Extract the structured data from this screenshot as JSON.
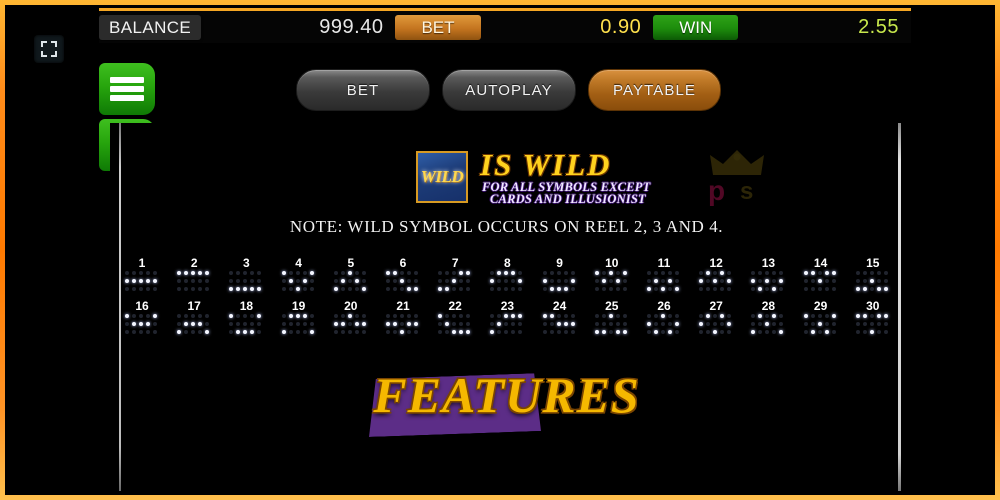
{
  "window": {
    "frame_color": "#ff8c1a",
    "background": "#000000"
  },
  "controls": {
    "fullscreen_icon": "fullscreen-expand-icon",
    "menu_icon": "hamburger-menu-icon",
    "back_icon": "back-arrow-icon"
  },
  "statusbar": {
    "balance_label": "BALANCE",
    "balance_value": "999.40",
    "bet_label": "BET",
    "bet_value": "0.90",
    "win_label": "WIN",
    "win_value": "2.55",
    "bet_color": "#c4741f",
    "win_color": "#1d8c0c",
    "value_colors": {
      "balance": "#e8e8e8",
      "bet": "#ffe14d",
      "win": "#c8e84d"
    }
  },
  "tabs": [
    {
      "label": "BET",
      "state": "inactive"
    },
    {
      "label": "AUTOPLAY",
      "state": "inactive"
    },
    {
      "label": "PAYTABLE",
      "state": "active"
    }
  ],
  "paytable": {
    "wild": {
      "tile_text": "WILD",
      "headline": "IS WILD",
      "subline_1": "FOR ALL SYMBOLS EXCEPT",
      "subline_2": "CARDS AND ILLUSIONIST",
      "headline_color": "#ffd21e"
    },
    "watermark": {
      "crown_icon": "crown-icon",
      "letter_p": "p",
      "letter_s": "s"
    },
    "note": "NOTE: WILD SYMBOL OCCURS ON REEL 2, 3 AND 4.",
    "reels": 5,
    "rows": 3,
    "paylines": [
      {
        "n": "1",
        "pattern": [
          1,
          1,
          1,
          1,
          1
        ]
      },
      {
        "n": "2",
        "pattern": [
          0,
          0,
          0,
          0,
          0
        ]
      },
      {
        "n": "3",
        "pattern": [
          2,
          2,
          2,
          2,
          2
        ]
      },
      {
        "n": "4",
        "pattern": [
          0,
          1,
          2,
          1,
          0
        ]
      },
      {
        "n": "5",
        "pattern": [
          2,
          1,
          0,
          1,
          2
        ]
      },
      {
        "n": "6",
        "pattern": [
          0,
          0,
          1,
          2,
          2
        ]
      },
      {
        "n": "7",
        "pattern": [
          2,
          2,
          1,
          0,
          0
        ]
      },
      {
        "n": "8",
        "pattern": [
          1,
          0,
          0,
          0,
          1
        ]
      },
      {
        "n": "9",
        "pattern": [
          1,
          2,
          2,
          2,
          1
        ]
      },
      {
        "n": "10",
        "pattern": [
          0,
          1,
          0,
          1,
          0
        ]
      },
      {
        "n": "11",
        "pattern": [
          2,
          1,
          2,
          1,
          2
        ]
      },
      {
        "n": "12",
        "pattern": [
          1,
          0,
          1,
          0,
          1
        ]
      },
      {
        "n": "13",
        "pattern": [
          1,
          2,
          1,
          2,
          1
        ]
      },
      {
        "n": "14",
        "pattern": [
          0,
          0,
          1,
          0,
          0
        ]
      },
      {
        "n": "15",
        "pattern": [
          2,
          2,
          1,
          2,
          2
        ]
      },
      {
        "n": "16",
        "pattern": [
          0,
          1,
          1,
          1,
          0
        ]
      },
      {
        "n": "17",
        "pattern": [
          2,
          1,
          1,
          1,
          2
        ]
      },
      {
        "n": "18",
        "pattern": [
          0,
          2,
          2,
          2,
          0
        ]
      },
      {
        "n": "19",
        "pattern": [
          2,
          0,
          0,
          0,
          2
        ]
      },
      {
        "n": "20",
        "pattern": [
          1,
          1,
          0,
          1,
          1
        ]
      },
      {
        "n": "21",
        "pattern": [
          1,
          1,
          2,
          1,
          1
        ]
      },
      {
        "n": "22",
        "pattern": [
          0,
          1,
          2,
          2,
          2
        ]
      },
      {
        "n": "23",
        "pattern": [
          2,
          1,
          0,
          0,
          0
        ]
      },
      {
        "n": "24",
        "pattern": [
          0,
          0,
          1,
          1,
          1
        ]
      },
      {
        "n": "25",
        "pattern": [
          2,
          2,
          0,
          2,
          2
        ]
      },
      {
        "n": "26",
        "pattern": [
          1,
          2,
          0,
          2,
          1
        ]
      },
      {
        "n": "27",
        "pattern": [
          1,
          0,
          2,
          0,
          1
        ]
      },
      {
        "n": "28",
        "pattern": [
          2,
          0,
          1,
          0,
          2
        ]
      },
      {
        "n": "29",
        "pattern": [
          0,
          2,
          1,
          2,
          0
        ]
      },
      {
        "n": "30",
        "pattern": [
          0,
          0,
          2,
          0,
          0
        ]
      }
    ],
    "features_title": "FEATURES"
  },
  "scrollbar": {
    "name": "vertical-scrollbar",
    "position": "right"
  }
}
